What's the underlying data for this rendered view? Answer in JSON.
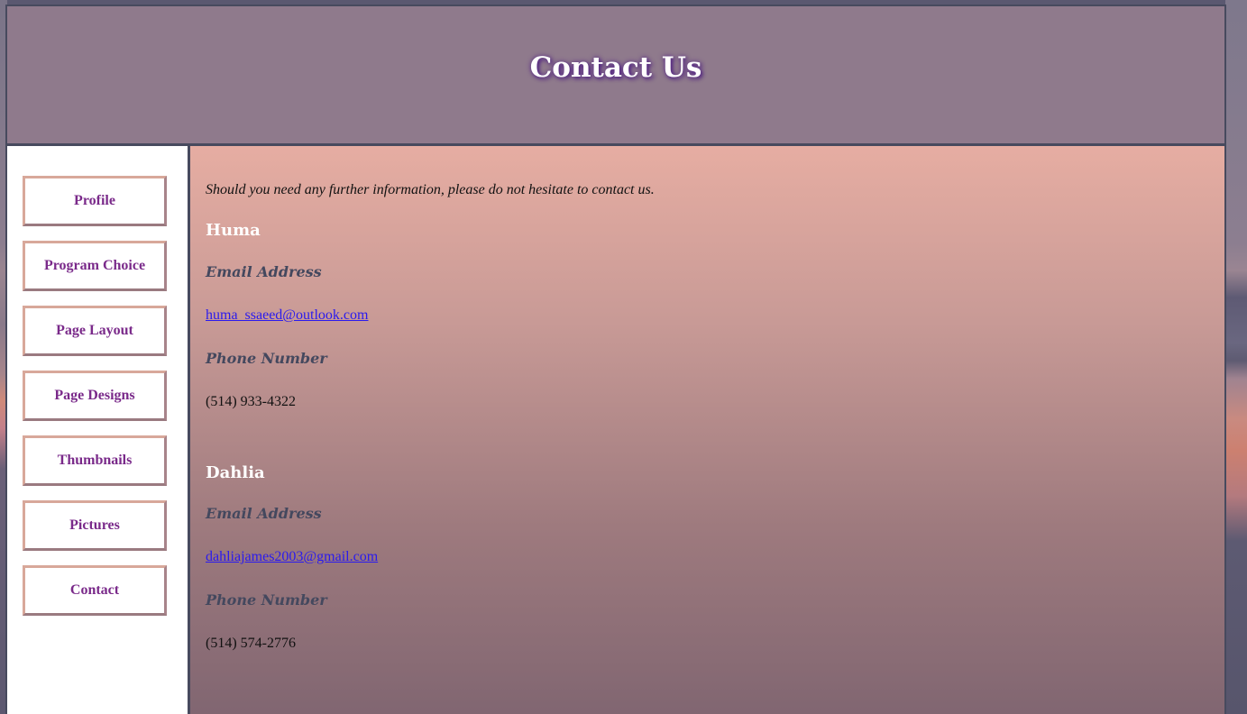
{
  "header": {
    "title": "Contact Us"
  },
  "sidebar": {
    "items": [
      {
        "label": "Profile"
      },
      {
        "label": "Program Choice"
      },
      {
        "label": "Page Layout"
      },
      {
        "label": "Page Designs"
      },
      {
        "label": "Thumbnails"
      },
      {
        "label": "Pictures"
      },
      {
        "label": "Contact"
      }
    ]
  },
  "main": {
    "intro": "Should you need any further information, please do not hesitate to contact us.",
    "contacts": [
      {
        "name": "Huma",
        "email_heading": "Email Address",
        "email": "huma_ssaeed@outlook.com",
        "phone_heading": "Phone Number",
        "phone": "(514) 933-4322"
      },
      {
        "name": "Dahlia",
        "email_heading": "Email Address",
        "email": "dahliajames2003@gmail.com",
        "phone_heading": "Phone Number",
        "phone": "(514) 574-2776"
      }
    ]
  },
  "colors": {
    "header_bg": "#8f7a8c",
    "border": "#474a5e",
    "nav_text": "#7a2a8a",
    "link": "#2a1aee",
    "content_gradient_top": "#e6ada2",
    "content_gradient_bottom": "#7e6470"
  }
}
